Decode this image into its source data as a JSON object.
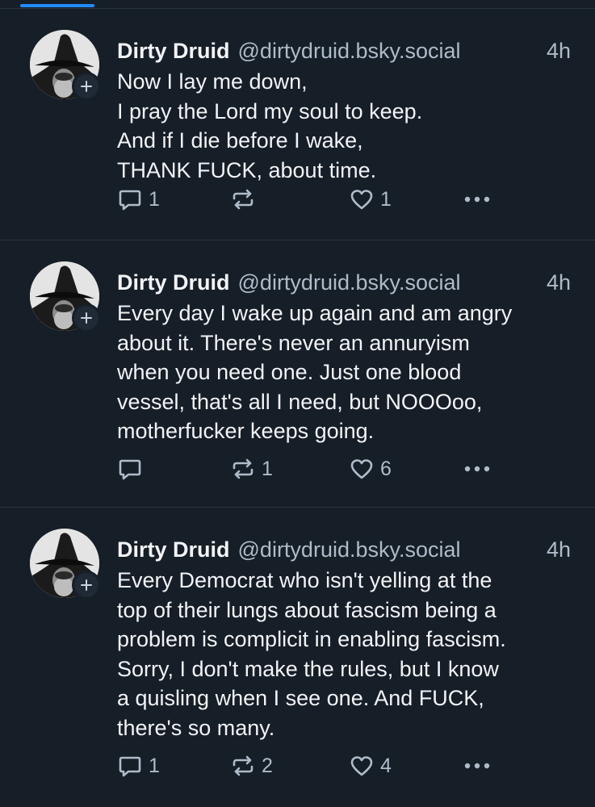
{
  "posts": [
    {
      "author_name": "Dirty Druid",
      "handle": "@dirtydruid.bsky.social",
      "time": "4h",
      "lines": [
        "Now I lay me down,",
        "I pray the Lord my soul to keep.",
        "And if I die before I wake,",
        "THANK FUCK, about time."
      ],
      "reply_count": "1",
      "repost_count": "",
      "like_count": "1"
    },
    {
      "author_name": "Dirty Druid",
      "handle": "@dirtydruid.bsky.social",
      "time": "4h",
      "lines": [
        "Every day I wake up again and am angry",
        "about it. There's never an annuryism",
        "when you need one. Just one blood",
        "vessel, that's all I need, but NOOOoo,",
        "motherfucker keeps going."
      ],
      "reply_count": "",
      "repost_count": "1",
      "like_count": "6"
    },
    {
      "author_name": "Dirty Druid",
      "handle": "@dirtydruid.bsky.social",
      "time": "4h",
      "lines": [
        "Every Democrat who isn't yelling at the",
        "top of their lungs about fascism being a",
        "problem is complicit in enabling fascism.",
        "Sorry, I don't make the rules, but I know",
        "a quisling when I see one. And FUCK,",
        "there's so many."
      ],
      "reply_count": "1",
      "repost_count": "2",
      "like_count": "4"
    }
  ],
  "colors": {
    "background": "#161e27",
    "text": "#f1f3f5",
    "muted": "#aebbc9",
    "accent": "#208bfe",
    "divider": "#2b3540"
  },
  "icons": [
    "follow-plus-icon",
    "reply-icon",
    "repost-icon",
    "like-icon",
    "more-icon"
  ]
}
